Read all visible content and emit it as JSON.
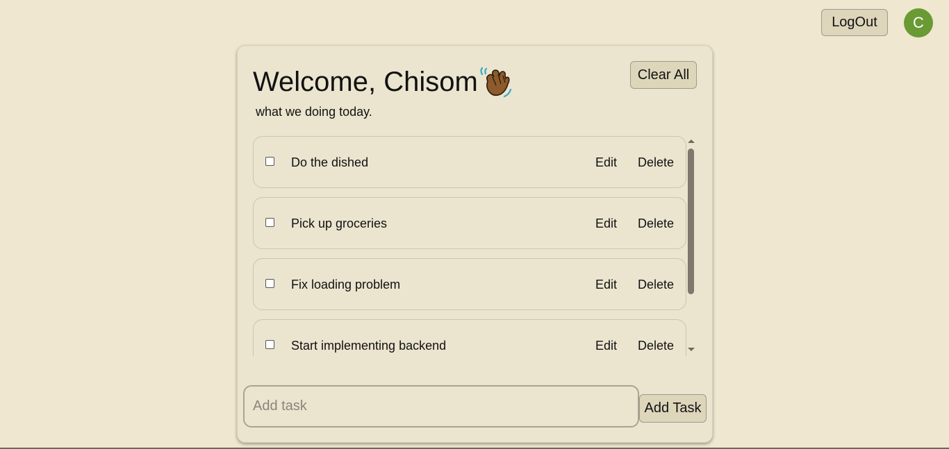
{
  "header": {
    "logout_label": "LogOut",
    "avatar_initial": "C"
  },
  "card": {
    "greeting": "Welcome, Chisom",
    "subtitle": "what we doing today.",
    "clear_all_label": "Clear All"
  },
  "tasks": [
    {
      "label": "Do the dished",
      "edit": "Edit",
      "delete": "Delete",
      "checked": false
    },
    {
      "label": "Pick up groceries",
      "edit": "Edit",
      "delete": "Delete",
      "checked": false
    },
    {
      "label": "Fix loading problem",
      "edit": "Edit",
      "delete": "Delete",
      "checked": false
    },
    {
      "label": "Start implementing backend",
      "edit": "Edit",
      "delete": "Delete",
      "checked": false
    }
  ],
  "add": {
    "placeholder": "Add task",
    "value": "",
    "button_label": "Add Task"
  },
  "colors": {
    "background": "#f0e7d0",
    "card": "#ebe4cf",
    "button": "#ddd6bb",
    "avatar": "#6a9a34"
  },
  "icons": {
    "greeting_icon": "waving-hand-icon"
  }
}
